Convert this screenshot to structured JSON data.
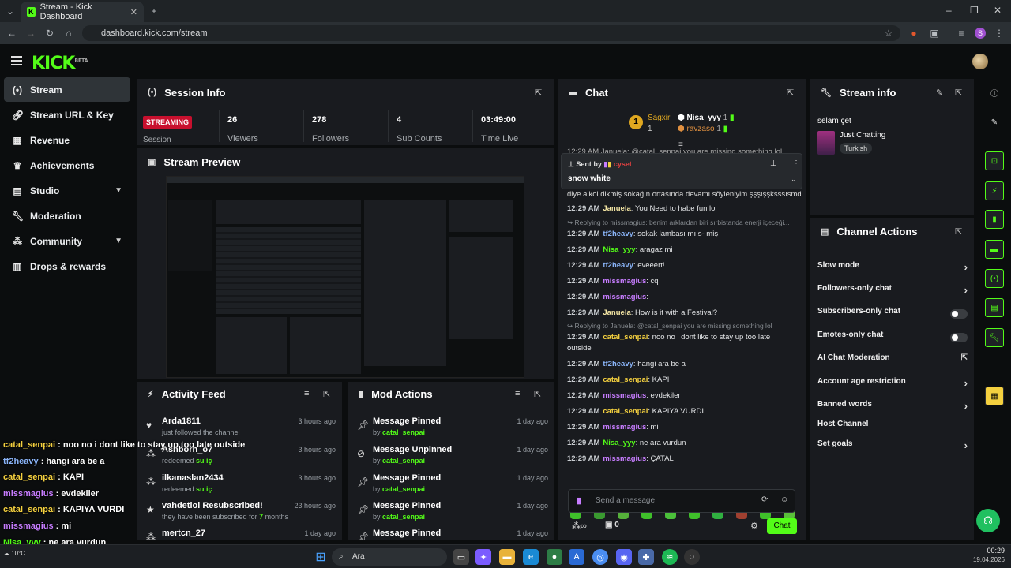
{
  "browser": {
    "tab_title": "Stream - Kick Dashboard",
    "url": "dashboard.kick.com/stream"
  },
  "brand": {
    "logo": "KICK",
    "beta": "BETA",
    "accent": "#53fc18"
  },
  "sidebar": {
    "items": [
      {
        "label": "Stream",
        "icon": "stream-icon"
      },
      {
        "label": "Stream URL & Key",
        "icon": "link-icon"
      },
      {
        "label": "Revenue",
        "icon": "revenue-icon"
      },
      {
        "label": "Achievements",
        "icon": "trophy-icon"
      },
      {
        "label": "Studio",
        "icon": "studio-icon"
      },
      {
        "label": "Moderation",
        "icon": "wrench-icon"
      },
      {
        "label": "Community",
        "icon": "community-icon"
      },
      {
        "label": "Drops & rewards",
        "icon": "drops-icon"
      }
    ]
  },
  "session": {
    "title": "Session Info",
    "status": "STREAMING",
    "status_label": "Session",
    "stats": [
      {
        "value": "26",
        "label": "Viewers"
      },
      {
        "value": "278",
        "label": "Followers"
      },
      {
        "value": "4",
        "label": "Sub Counts"
      },
      {
        "value": "03:49:00",
        "label": "Time Live"
      }
    ]
  },
  "preview": {
    "title": "Stream Preview"
  },
  "activity": {
    "title": "Activity Feed",
    "rows": [
      {
        "name": "Arda1811",
        "sub": "just followed the channel",
        "sub_hl": "",
        "time": "3 hours ago",
        "icon": "heart-icon"
      },
      {
        "name": "Ashborn_o7",
        "sub": "redeemed",
        "sub_hl": "su iç",
        "time": "3 hours ago",
        "icon": "gift-icon"
      },
      {
        "name": "ilkanaslan2434",
        "sub": "redeemed",
        "sub_hl": "su iç",
        "time": "3 hours ago",
        "icon": "gift-icon"
      },
      {
        "name": "vahdetlol Resubscribed!",
        "sub": "they have been subscribed for",
        "sub_hl": "7",
        "sub_tail": "months",
        "time": "23 hours ago",
        "icon": "star-icon"
      },
      {
        "name": "mertcn_27",
        "sub": "",
        "sub_hl": "",
        "time": "1 day ago",
        "icon": "gift-icon"
      }
    ]
  },
  "mod": {
    "title": "Mod Actions",
    "rows": [
      {
        "action": "Message Pinned",
        "by": "by",
        "user": "catal_senpai",
        "time": "1 day ago",
        "icon": "pin-icon"
      },
      {
        "action": "Message Unpinned",
        "by": "by",
        "user": "catal_senpai",
        "time": "1 day ago",
        "icon": "unpin-icon"
      },
      {
        "action": "Message Pinned",
        "by": "by",
        "user": "catal_senpai",
        "time": "1 day ago",
        "icon": "pin-icon"
      },
      {
        "action": "Message Pinned",
        "by": "by",
        "user": "catal_senpai",
        "time": "1 day ago",
        "icon": "pin-icon"
      },
      {
        "action": "Message Pinned",
        "by": "",
        "user": "",
        "time": "1 day ago",
        "icon": "pin-icon"
      }
    ]
  },
  "chat": {
    "title": "Chat",
    "leaders": [
      {
        "rank": "1",
        "name": "Sagxiri",
        "count": "1"
      },
      {
        "name": "Nisa_yyy",
        "count": "1"
      },
      {
        "name": "ravzaso",
        "count": "1"
      }
    ],
    "pinned": {
      "sent_by": "Sent by",
      "user": "cyset",
      "message": "snow white"
    },
    "top_partial": "12:29 AM Januela: @catal_senpai you are missing something lol",
    "top_cut": "diye alkol dikmiş sokağın ortasında devamı söyleniyim şşşışşksssısmd",
    "messages": [
      {
        "type": "msg",
        "time": "12:29 AM",
        "user": "Januela",
        "color": "#f4e6a4",
        "text": "You Need to habe fun lol"
      },
      {
        "type": "reply",
        "text": "Replying to missmagius: benim arklardan biri sırbistanda enerji içeceği..."
      },
      {
        "type": "msg",
        "time": "12:29 AM",
        "user": "tf2heavy",
        "color": "#8ab4f8",
        "text": "sokak lambası mı s- miş"
      },
      {
        "type": "msg",
        "time": "12:29 AM",
        "user": "Nisa_yyy",
        "color": "#53fc18",
        "text": "aragaz mi"
      },
      {
        "type": "msg",
        "time": "12:29 AM",
        "user": "tf2heavy",
        "color": "#8ab4f8",
        "text": "eveeert!"
      },
      {
        "type": "msg",
        "time": "12:29 AM",
        "user": "missmagius",
        "color": "#c77dff",
        "text": "cq"
      },
      {
        "type": "msg",
        "time": "12:29 AM",
        "user": "missmagius",
        "color": "#c77dff",
        "text": ""
      },
      {
        "type": "msg",
        "time": "12:29 AM",
        "user": "Januela",
        "color": "#f4e6a4",
        "text": "How is it with a Festival?"
      },
      {
        "type": "reply",
        "text": "Replying to Januela: @catal_senpai you are missing something lol"
      },
      {
        "type": "msg",
        "time": "12:29 AM",
        "user": "catal_senpai",
        "color": "#f4d03f",
        "text": "noo no i dont like to stay up too late"
      },
      {
        "type": "cont",
        "text": "outside"
      },
      {
        "type": "msg",
        "time": "12:29 AM",
        "user": "tf2heavy",
        "color": "#8ab4f8",
        "text": "hangi ara be a"
      },
      {
        "type": "msg",
        "time": "12:29 AM",
        "user": "catal_senpai",
        "color": "#f4d03f",
        "text": "KAPI"
      },
      {
        "type": "msg",
        "time": "12:29 AM",
        "user": "missmagius",
        "color": "#c77dff",
        "text": "evdekiler"
      },
      {
        "type": "msg",
        "time": "12:29 AM",
        "user": "catal_senpai",
        "color": "#f4d03f",
        "text": "KAPIYA VURDI"
      },
      {
        "type": "msg",
        "time": "12:29 AM",
        "user": "missmagius",
        "color": "#c77dff",
        "text": "mi"
      },
      {
        "type": "msg",
        "time": "12:29 AM",
        "user": "Nisa_yyy",
        "color": "#53fc18",
        "text": "ne ara vurdun"
      },
      {
        "type": "msg",
        "time": "12:29 AM",
        "user": "missmagius",
        "color": "#c77dff",
        "text": "ÇATAL"
      }
    ],
    "input_placeholder": "Send a message",
    "points": "0",
    "send_label": "Chat"
  },
  "stream_info": {
    "title": "Stream info",
    "stream_title": "selam çet",
    "category": "Just Chatting",
    "tag": "Turkish"
  },
  "channel_actions": {
    "title": "Channel Actions",
    "items": [
      {
        "label": "Slow mode",
        "control": "chevron"
      },
      {
        "label": "Followers-only chat",
        "control": "chevron"
      },
      {
        "label": "Subscribers-only chat",
        "control": "toggle",
        "on": false
      },
      {
        "label": "Emotes-only chat",
        "control": "toggle",
        "on": false
      },
      {
        "label": "AI Chat Moderation",
        "control": "external"
      },
      {
        "label": "Account age restriction",
        "control": "chevron"
      },
      {
        "label": "Banned words",
        "control": "chevron"
      },
      {
        "label": "Host Channel",
        "control": "none"
      },
      {
        "label": "Set goals",
        "control": "chevron"
      }
    ]
  },
  "overlay_chat": [
    {
      "user": "catal_senpai",
      "color": "#f4d03f",
      "text": ": noo no i dont like to stay up too late outside"
    },
    {
      "user": "tf2heavy",
      "color": "#8ab4f8",
      "text": ": hangi ara be a"
    },
    {
      "user": "catal_senpai",
      "color": "#f4d03f",
      "text": ": KAPI"
    },
    {
      "user": "missmagius",
      "color": "#c77dff",
      "text": ": evdekiler"
    },
    {
      "user": "catal_senpai",
      "color": "#f4d03f",
      "text": ": KAPIYA VURDI"
    },
    {
      "user": "missmagius",
      "color": "#c77dff",
      "text": ": mi"
    },
    {
      "user": "Nisa_yyy",
      "color": "#53fc18",
      "text": ": ne ara vurdun"
    },
    {
      "user": "missmagius",
      "color": "#c77dff",
      "text": ": ÇATAL"
    }
  ],
  "taskbar": {
    "search": "Ara",
    "weather": "10°C",
    "time": "00:29",
    "date": "19.04.2026"
  }
}
